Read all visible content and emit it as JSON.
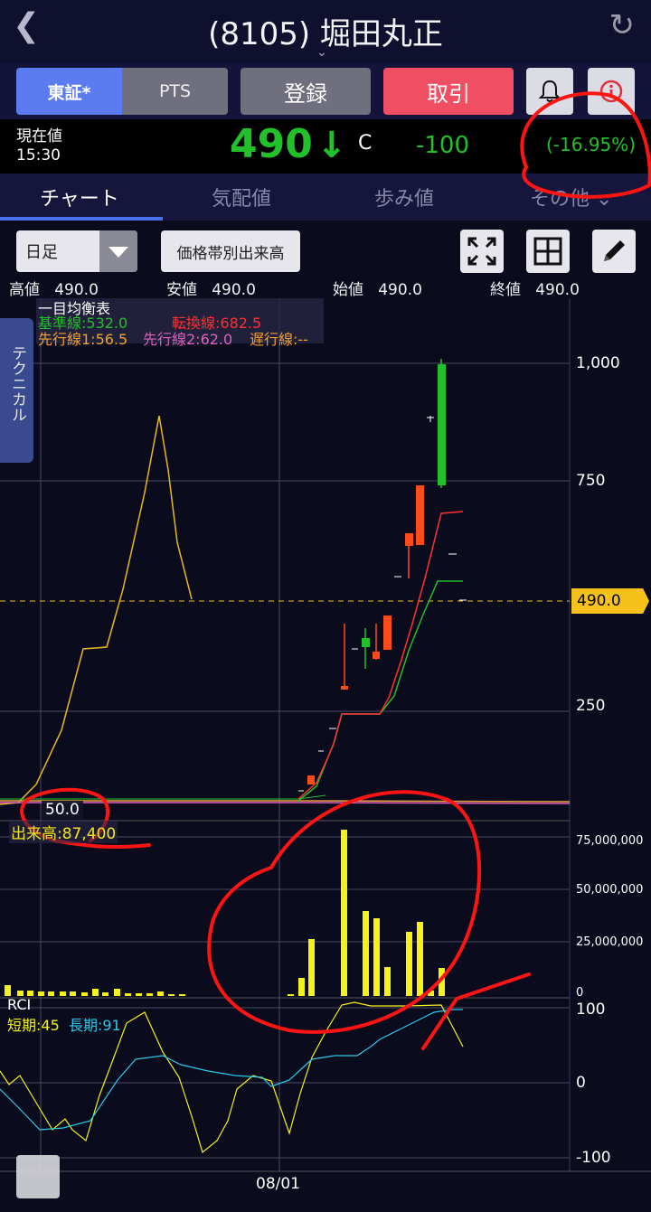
{
  "header": {
    "title": "(8105) 堀田丸正"
  },
  "buttons": {
    "seg_tse": "東証*",
    "seg_pts": "PTS",
    "register": "登録",
    "trade": "取引"
  },
  "price": {
    "label": "現在値",
    "time": "15:30",
    "value": "490",
    "condition": "C",
    "change": "-100",
    "change_pct": "(-16.95%)",
    "down_color": "#22c02a"
  },
  "tabs": [
    "チャート",
    "気配値",
    "歩み値",
    "その他"
  ],
  "toolbar": {
    "period": "日足",
    "volume_by_price": "価格帯別出来高"
  },
  "ohlc": {
    "high_label": "高値",
    "high": "490.0",
    "low_label": "安値",
    "low": "490.0",
    "open_label": "始値",
    "open": "490.0",
    "close_label": "終値",
    "close": "490.0"
  },
  "side_tab": "テクニカル",
  "ichimoku": {
    "title": "一目均衡表",
    "kijun": "基準線:532.0",
    "tenkan": "転換線:682.5",
    "senko1": "先行線1:56.5",
    "senko2": "先行線2:62.0",
    "chikou": "遅行線:--"
  },
  "price_axis": [
    "1,000",
    "750",
    "250"
  ],
  "current_price_tag": "490.0",
  "marker_value": "50.0",
  "volume": {
    "label": "出来高:87,400",
    "axis": [
      "75,000,000",
      "50,000,000",
      "25,000,000",
      "0"
    ]
  },
  "rci": {
    "title": "RCI",
    "short": "短期:45",
    "long": "長期:91",
    "axis": [
      "100",
      "0",
      "-100"
    ]
  },
  "date_label": "08/01",
  "colors": {
    "up": "#ff4a1a",
    "down": "#22c02a",
    "volume": "#f5f218",
    "accent": "#4a6ef0"
  }
}
